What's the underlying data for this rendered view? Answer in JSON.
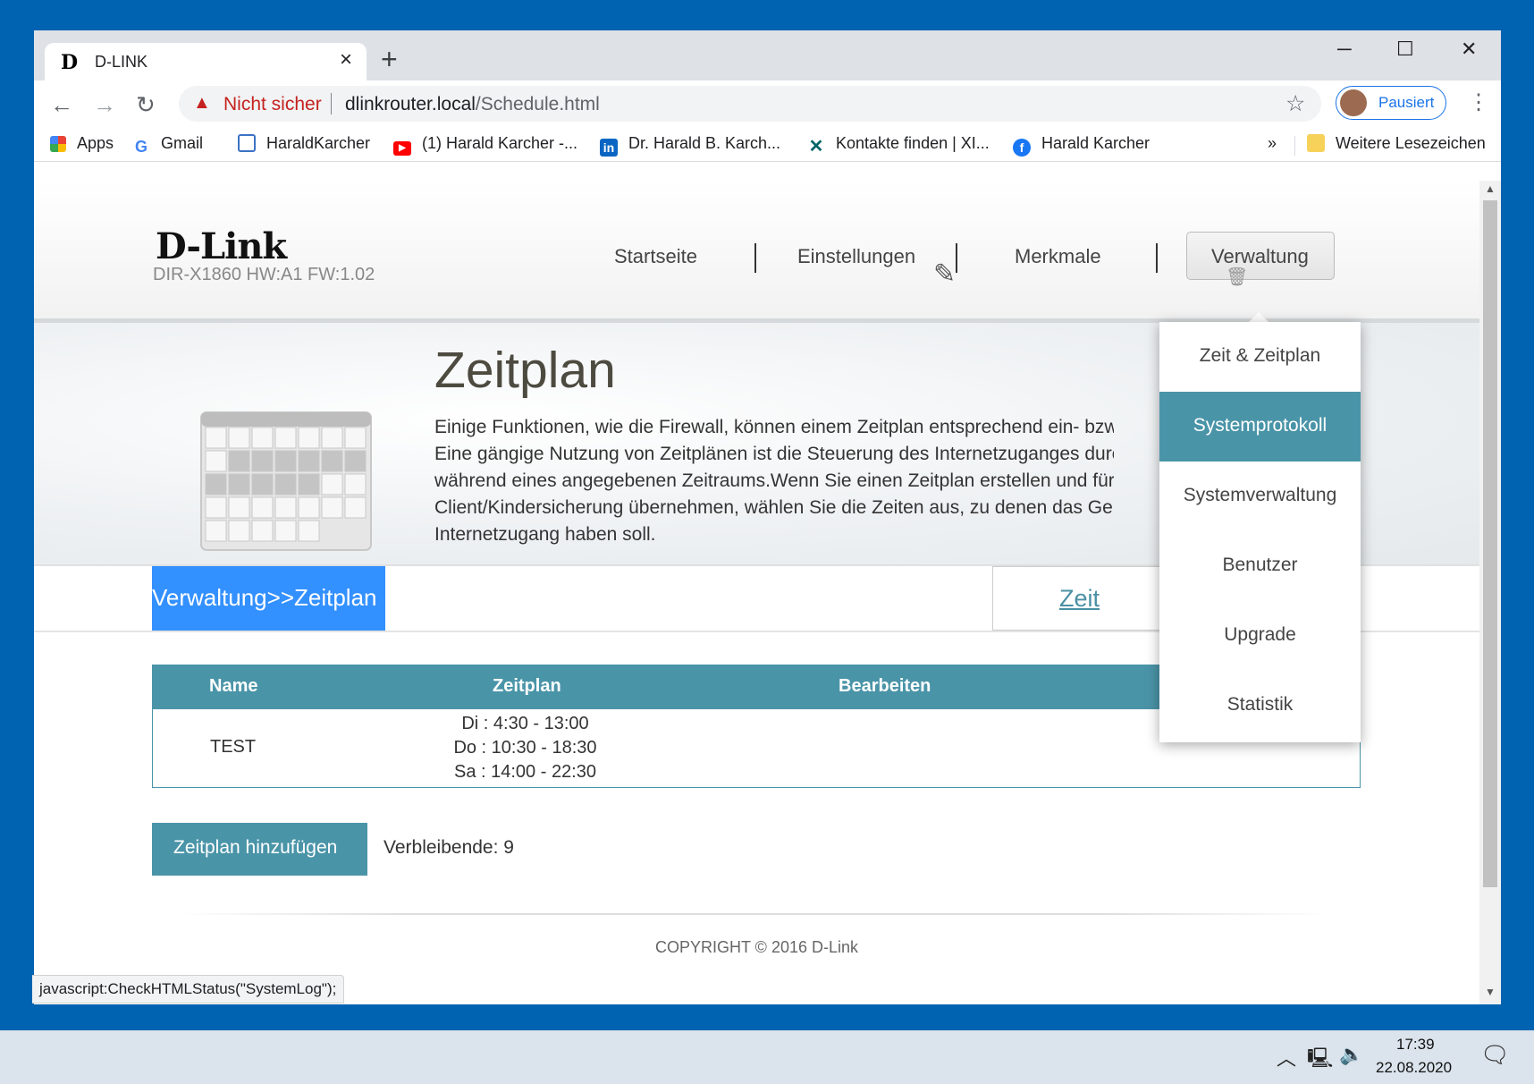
{
  "browser": {
    "tab_title": "D-LINK",
    "tab_favicon_glyph": "D",
    "new_tab_glyph": "+",
    "window_controls": {
      "minimize": "─",
      "maximize": "☐",
      "close": "✕"
    },
    "security_label": "Nicht sicher",
    "url_host": "dlinkrouter.local",
    "url_path": "/Schedule.html",
    "profile_label": "Pausiert",
    "status_url": "javascript:CheckHTMLStatus(\"SystemLog\");"
  },
  "bookmarks": {
    "items": [
      {
        "label": "Apps",
        "icon": "apps-grid-icon"
      },
      {
        "label": "Gmail",
        "icon": "google-icon"
      },
      {
        "label": "HaraldKarcher",
        "icon": "page-icon"
      },
      {
        "label": "(1) Harald Karcher -...",
        "icon": "youtube-icon"
      },
      {
        "label": "Dr. Harald B. Karch...",
        "icon": "linkedin-icon"
      },
      {
        "label": "Kontakte finden | XI...",
        "icon": "xing-icon"
      },
      {
        "label": "Harald Karcher",
        "icon": "facebook-icon"
      }
    ],
    "overflow": "»",
    "other_folder": "Weitere Lesezeichen"
  },
  "router": {
    "brand": "D-Link",
    "model": "DIR-X1860 HW:A1 FW:1.02",
    "menu": [
      "Startseite",
      "Einstellungen",
      "Merkmale",
      "Verwaltung"
    ],
    "active_menu": "Verwaltung",
    "dropdown": [
      "Zeit & Zeitplan",
      "Systemprotokoll",
      "Systemverwaltung",
      "Benutzer",
      "Upgrade",
      "Statistik"
    ],
    "dropdown_active": "Systemprotokoll"
  },
  "page": {
    "title": "Zeitplan",
    "description_lines": [
      "Einige Funktionen, wie die Firewall, können einem Zeitplan entsprechend ein- bzw.",
      "Eine gängige Nutzung von Zeitplänen ist die Steuerung des Internetzuganges durch",
      "während eines angegebenen Zeitraums.Wenn Sie einen Zeitplan erstellen und für e",
      "Client/Kindersicherung übernehmen, wählen Sie die Zeiten aus, zu denen das Gerä",
      "Internetzugang haben soll."
    ],
    "breadcrumb": "Verwaltung>>Zeitplan",
    "time_link": "Zeit"
  },
  "table": {
    "headers": [
      "Name",
      "Zeitplan",
      "Bearbeiten"
    ],
    "rows": [
      {
        "name": "TEST",
        "schedule": [
          "Di : 4:30 - 13:00",
          "Do : 10:30 - 18:30",
          "Sa : 14:00 - 22:30"
        ]
      }
    ]
  },
  "actions": {
    "add_button": "Zeitplan hinzufügen",
    "remaining": "Verbleibende: 9"
  },
  "footer": {
    "copyright": "COPYRIGHT © 2016 D-Link"
  },
  "taskbar": {
    "time": "17:39",
    "date": "22.08.2020"
  },
  "colors": {
    "desktop": "#0063b1",
    "teal": "#4a94a8",
    "breadcrumb_blue": "#3390ff",
    "warning_red": "#c5221f",
    "chrome_blue": "#1a73e8"
  }
}
